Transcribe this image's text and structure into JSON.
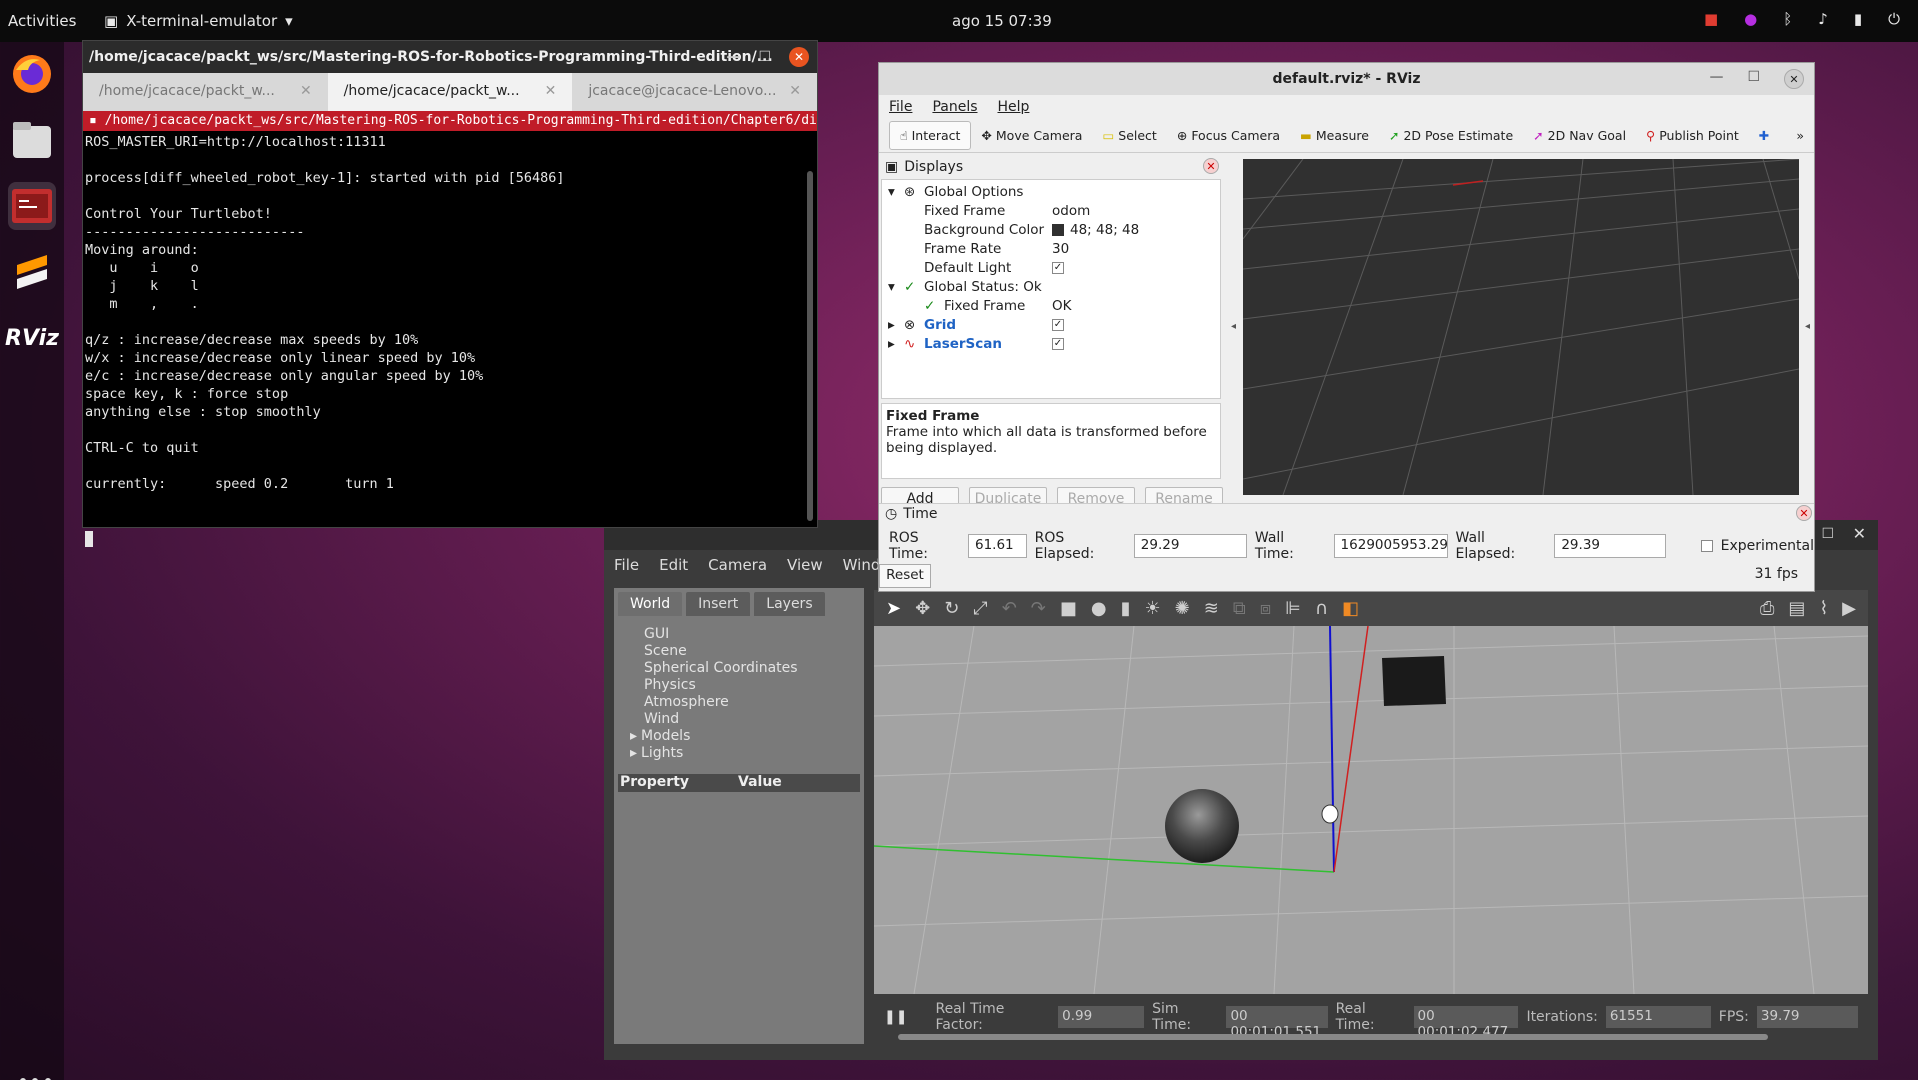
{
  "topbar": {
    "activities": "Activities",
    "app_name": "X-terminal-emulator",
    "clock": "ago 15  07:39"
  },
  "dock": {
    "items": [
      "firefox-icon",
      "files-icon",
      "terminal-icon",
      "sublime-icon",
      "rviz-icon"
    ],
    "rviz_label": "RViz"
  },
  "terminal": {
    "title": "/home/jcacace/packt_ws/src/Mastering-ROS-for-Robotics-Programming-Third-edition/...",
    "tabs": [
      "/home/jcacace/packt_w...",
      "/home/jcacace/packt_w...",
      "jcacace@jcacace-Lenovo..."
    ],
    "path_bar": "/home/jcacace/packt_ws/src/Mastering-ROS-for-Robotics-Programming-Third-edition/Chapter6/diff_whe",
    "output": "ROS_MASTER_URI=http://localhost:11311\n\nprocess[diff_wheeled_robot_key-1]: started with pid [56486]\n\nControl Your Turtlebot!\n---------------------------\nMoving around:\n   u    i    o\n   j    k    l\n   m    ,    .\n\nq/z : increase/decrease max speeds by 10%\nw/x : increase/decrease only linear speed by 10%\ne/c : increase/decrease only angular speed by 10%\nspace key, k : force stop\nanything else : stop smoothly\n\nCTRL-C to quit\n\ncurrently:      speed 0.2       turn 1"
  },
  "rviz": {
    "title": "default.rviz* - RViz",
    "menu": [
      "File",
      "Panels",
      "Help"
    ],
    "tools": [
      "Interact",
      "Move Camera",
      "Select",
      "Focus Camera",
      "Measure",
      "2D Pose Estimate",
      "2D Nav Goal",
      "Publish Point"
    ],
    "displays": {
      "header": "Displays",
      "global_options": "Global Options",
      "fixed_frame_label": "Fixed Frame",
      "fixed_frame_value": "odom",
      "bg_color_label": "Background Color",
      "bg_color_value": "48; 48; 48",
      "frame_rate_label": "Frame Rate",
      "frame_rate_value": "30",
      "default_light_label": "Default Light",
      "global_status": "Global Status: Ok",
      "status_fixed_frame": "Fixed Frame",
      "status_fixed_frame_value": "OK",
      "grid": "Grid",
      "laserscan": "LaserScan",
      "desc_title": "Fixed Frame",
      "desc_text": "Frame into which all data is transformed before being displayed.",
      "buttons": [
        "Add",
        "Duplicate",
        "Remove",
        "Rename"
      ]
    },
    "time": {
      "header": "Time",
      "ros_time_label": "ROS Time:",
      "ros_time": "61.61",
      "ros_elapsed_label": "ROS Elapsed:",
      "ros_elapsed": "29.29",
      "wall_time_label": "Wall Time:",
      "wall_time": "1629005953.29",
      "wall_elapsed_label": "Wall Elapsed:",
      "wall_elapsed": "29.39",
      "experimental": "Experimental",
      "reset": "Reset",
      "fps": "31 fps"
    }
  },
  "gazebo": {
    "menu": [
      "File",
      "Edit",
      "Camera",
      "View",
      "Window"
    ],
    "tabs": [
      "World",
      "Insert",
      "Layers"
    ],
    "world_items": [
      "GUI",
      "Scene",
      "Spherical Coordinates",
      "Physics",
      "Atmosphere",
      "Wind"
    ],
    "expandable_items": [
      "Models",
      "Lights"
    ],
    "property_header": "Property",
    "value_header": "Value",
    "status": {
      "rtf_label": "Real Time Factor:",
      "rtf": "0.99",
      "sim_label": "Sim Time:",
      "sim": "00 00:01:01.551",
      "real_label": "Real Time:",
      "real": "00 00:01:02.477",
      "iter_label": "Iterations:",
      "iter": "61551",
      "fps_label": "FPS:",
      "fps": "39.79"
    }
  },
  "colors": {
    "ubuntu_orange": "#e95420",
    "terminal_red": "#c01c28",
    "rviz_bg": "#303030",
    "gazebo_ground": "#9a9a9a"
  }
}
